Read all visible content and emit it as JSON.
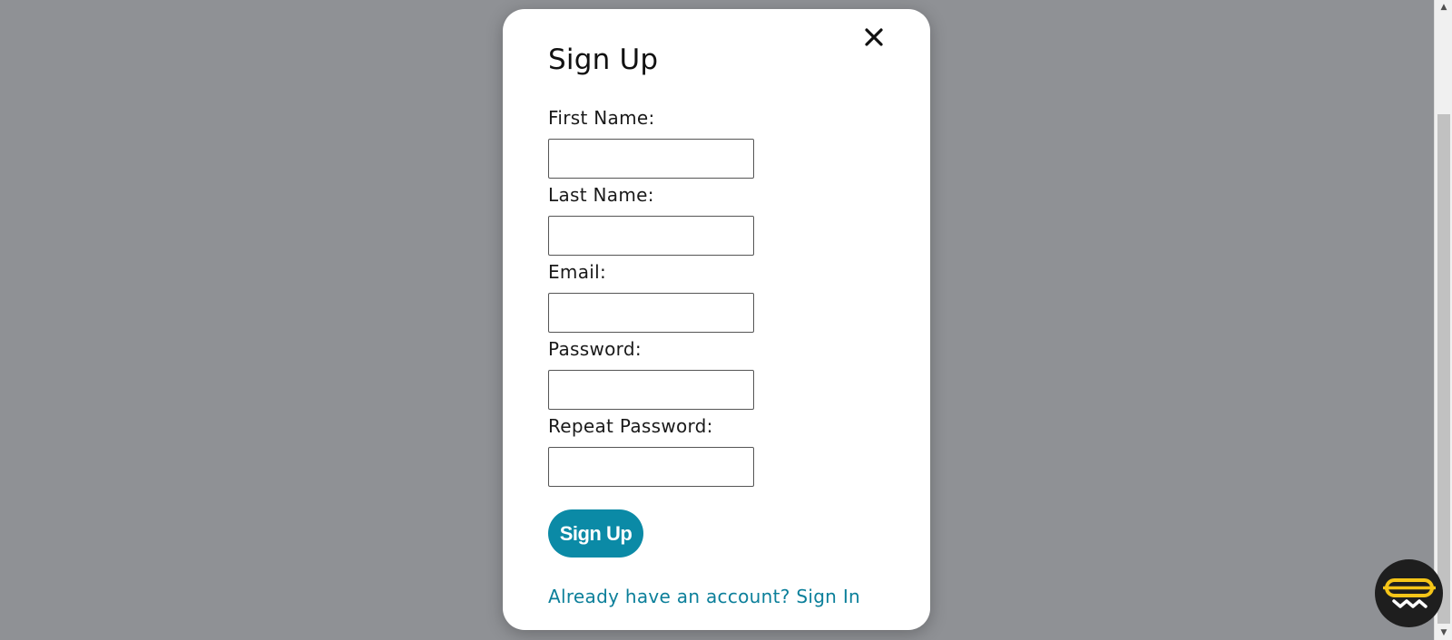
{
  "modal": {
    "title": "Sign Up",
    "fields": [
      {
        "label": "First Name:",
        "value": "",
        "placeholder": ""
      },
      {
        "label": "Last Name:",
        "value": "",
        "placeholder": ""
      },
      {
        "label": "Email:",
        "value": "",
        "placeholder": ""
      },
      {
        "label": "Password:",
        "value": "",
        "placeholder": ""
      },
      {
        "label": "Repeat Password:",
        "value": "",
        "placeholder": ""
      }
    ],
    "submit_label": "Sign Up",
    "signin_link": "Already have an account? Sign In"
  },
  "icons": {
    "close": "close-icon",
    "widget": "hotdog-icon"
  },
  "colors": {
    "overlay": "#8f9195",
    "accent": "#0b8aa6",
    "link": "#0b7f9a",
    "widget_bg": "#1e1e1e",
    "widget_icon": "#f5c518"
  }
}
